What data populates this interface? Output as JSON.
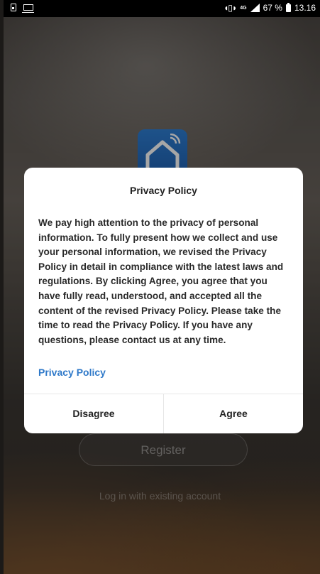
{
  "status_bar": {
    "network": "4G",
    "battery": "67 %",
    "time": "13.16"
  },
  "background": {
    "register_label": "Register",
    "login_link": "Log in with existing account"
  },
  "dialog": {
    "title": "Privacy Policy",
    "body": "We pay high attention to the privacy of personal information. To fully present how we collect and use your personal information, we revised the Privacy Policy in detail in compliance with the latest laws and regulations. By clicking Agree, you agree that you have fully read, understood, and accepted all the content of the revised Privacy Policy. Please take the time to read the Privacy Policy. If you have any questions, please contact us at any time.",
    "link": "Privacy Policy",
    "disagree_label": "Disagree",
    "agree_label": "Agree"
  },
  "colors": {
    "link": "#2f79c9",
    "logo": "#2670c4"
  }
}
